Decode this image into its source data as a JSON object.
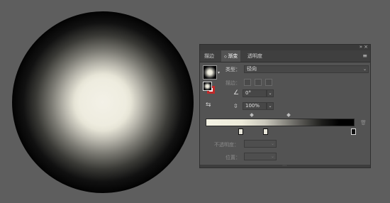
{
  "panel": {
    "tabs": [
      "描边",
      "渐变",
      "透明度"
    ],
    "active_tab_index": 1,
    "collapse_glyph": "»",
    "close_glyph": "×",
    "menu_glyph": "≡"
  },
  "gradient": {
    "type_label": "类型：",
    "type_value": "径向",
    "stroke_label": "描边：",
    "angle_value": "0°",
    "aspect_value": "100%",
    "opacity_label": "不透明度：",
    "position_label": "位置：",
    "opacity_value": "",
    "position_value": "",
    "stops": [
      {
        "location": 0.23,
        "color": "#eeecdf"
      },
      {
        "location": 0.4,
        "color": "#e6e4d6"
      },
      {
        "location": 1.0,
        "color": "#000000"
      }
    ],
    "midpoints": [
      0.32,
      0.56
    ]
  },
  "icons": {
    "dropdown": "⌄",
    "preview_arrow": "▾",
    "angle": "∠",
    "aspect": "⇳",
    "swap": "⇆",
    "trash": "🗑",
    "grip": "⋯"
  },
  "colors": {
    "accent_stroke": "#c02a2a",
    "panel_bg": "#535353",
    "workspace_bg": "#5e5e5e"
  }
}
